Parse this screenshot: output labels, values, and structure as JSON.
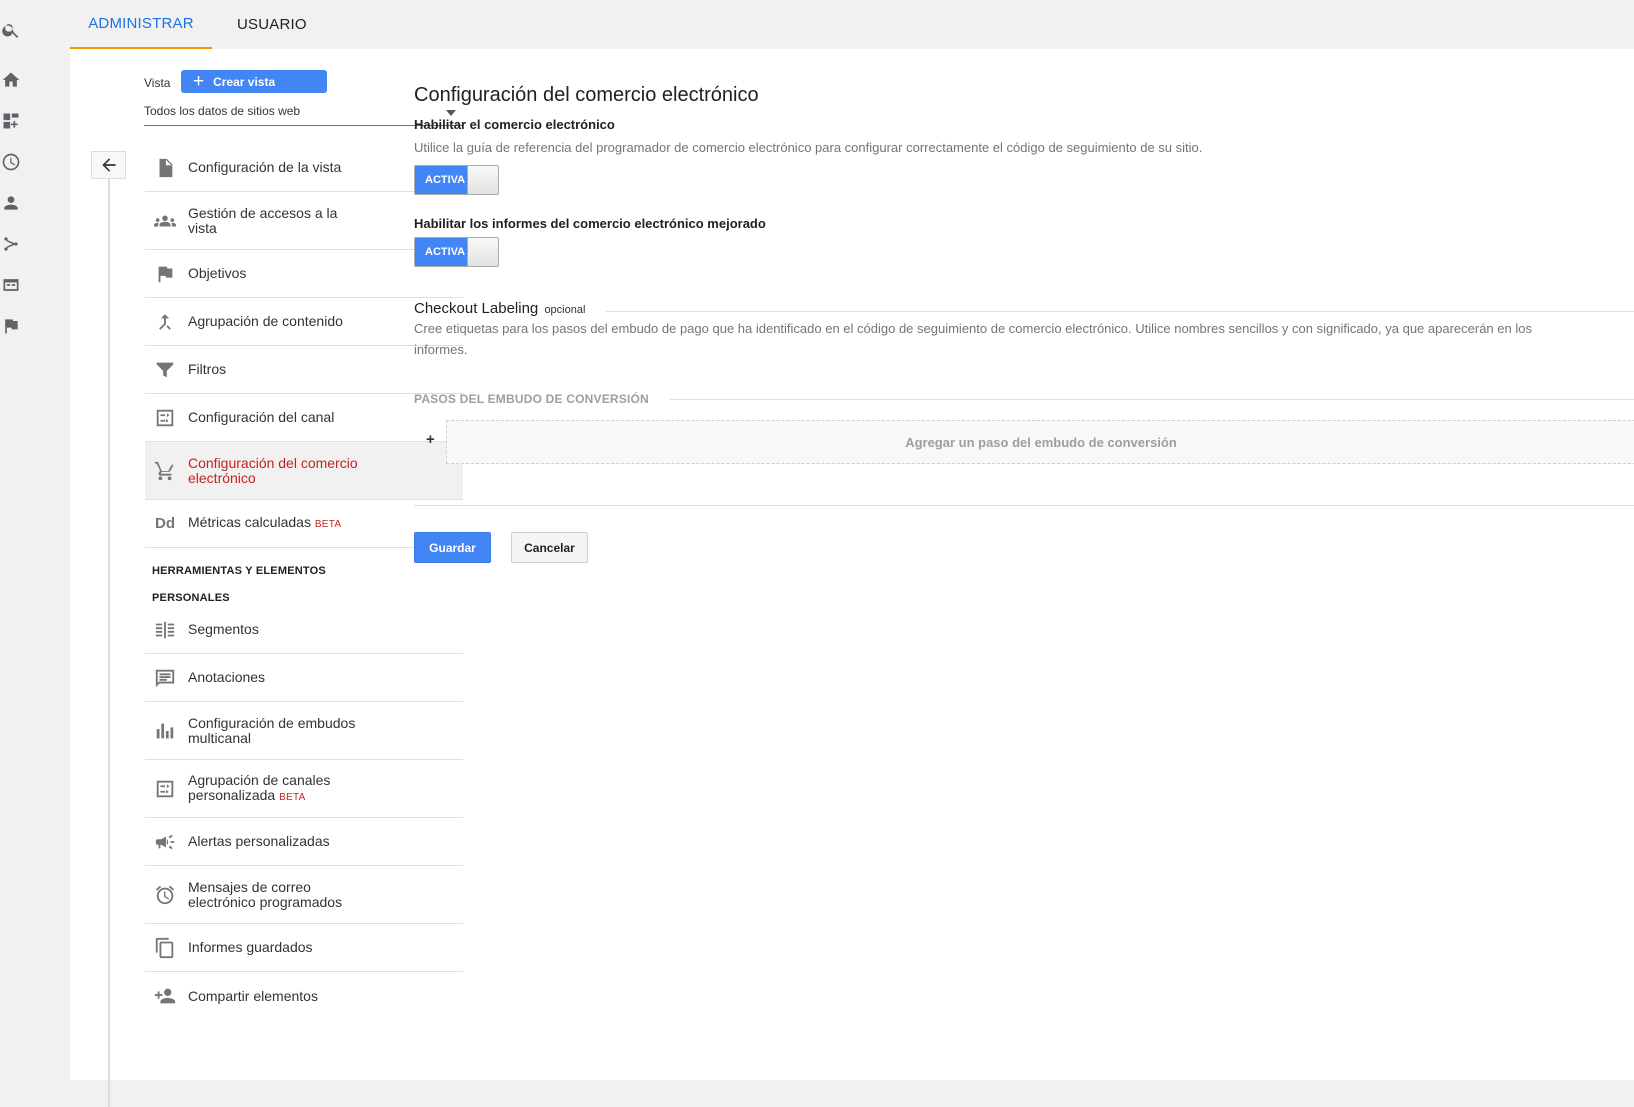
{
  "tabs": [
    {
      "label": "ADMINISTRAR",
      "active": true
    },
    {
      "label": "USUARIO",
      "active": false
    }
  ],
  "rail_icons": [
    "search-icon",
    "home-icon",
    "dashboard-icon",
    "clock-icon",
    "person-icon",
    "fork-icon",
    "display-icon",
    "flag-icon"
  ],
  "sidebar": {
    "vista_label": "Vista",
    "crear_vista": "Crear vista",
    "view_select": "Todos los datos de sitios web",
    "items": [
      {
        "label": "Configuración de la vista",
        "icon": "document-icon"
      },
      {
        "label": "Gestión de accesos a la vista",
        "icon": "group-icon"
      },
      {
        "label": "Objetivos",
        "icon": "flag-icon"
      },
      {
        "label": "Agrupación de contenido",
        "icon": "merge-icon"
      },
      {
        "label": "Filtros",
        "icon": "filter-icon"
      },
      {
        "label": "Configuración del canal",
        "icon": "channel-icon"
      },
      {
        "label": "Configuración del comercio electrónico",
        "icon": "cart-icon",
        "selected": true
      },
      {
        "label": "Métricas calculadas",
        "icon": "dd-icon",
        "badge": "BETA"
      }
    ],
    "tools_header": "HERRAMIENTAS Y ELEMENTOS",
    "personal_header": "PERSONALES",
    "personal_items": [
      {
        "label": "Segmentos",
        "icon": "segments-icon"
      },
      {
        "label": "Anotaciones",
        "icon": "comment-icon"
      },
      {
        "label": "Configuración de embudos multicanal",
        "icon": "bar-chart-icon"
      },
      {
        "label": "Agrupación de canales personalizada",
        "icon": "channel-icon",
        "badge": "BETA"
      },
      {
        "label": "Alertas personalizadas",
        "icon": "megaphone-icon"
      },
      {
        "label": "Mensajes de correo electrónico programados",
        "icon": "alarm-icon"
      },
      {
        "label": "Informes guardados",
        "icon": "copy-icon"
      },
      {
        "label": "Compartir elementos",
        "icon": "person-add-icon"
      }
    ]
  },
  "main": {
    "title": "Configuración del comercio electrónico",
    "enable_ecommerce_label": "Habilitar el comercio electrónico",
    "enable_ecommerce_desc": "Utilice la guía de referencia del programador de comercio electrónico para configurar correctamente el código de seguimiento de su sitio.",
    "toggle_text": "ACTIVA",
    "enhanced_label": "Habilitar los informes del comercio electrónico mejorado",
    "checkout_title": "Checkout Labeling",
    "checkout_optional": "opcional",
    "checkout_desc": "Cree etiquetas para los pasos del embudo de pago que ha identificado en el código de seguimiento de comercio electrónico. Utilice nombres sencillos y con significado, ya que aparecerán en los informes.",
    "steps_title": "PASOS DEL EMBUDO DE CONVERSIÓN",
    "add_step_plus": "+",
    "add_step": "Agregar un paso del embudo de conversión",
    "save": "Guardar",
    "cancel": "Cancelar"
  },
  "colors": {
    "accent": "#4285f4",
    "selected": "#c5221f",
    "tab_underline": "#f29900",
    "tab_active": "#1a73e8"
  }
}
